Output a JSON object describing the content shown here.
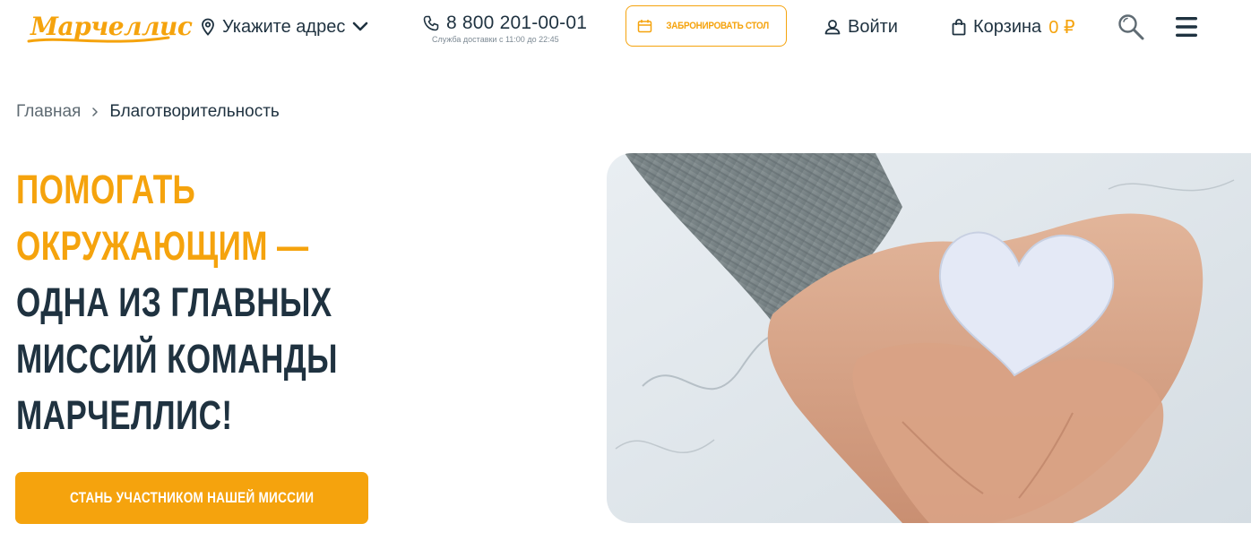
{
  "header": {
    "logo_text": "Марчеллис",
    "address_label": "Укажите адрес",
    "phone_number": "8 800 201-00-01",
    "phone_hours": "Служба доставки с 11:00 до 22:45",
    "book_table_label": "Забронировать стол",
    "login_label": "Войти",
    "cart_label": "Корзина",
    "cart_amount": "0 ₽",
    "icons": {
      "address": "location-pin-icon",
      "address_dropdown": "chevron-down-icon",
      "phone": "phone-icon",
      "book": "calendar-icon",
      "login": "user-icon",
      "cart": "shopping-bag-icon",
      "search": "search-icon",
      "menu": "hamburger-menu-icon"
    }
  },
  "breadcrumb": {
    "home": "Главная",
    "current": "Благотворительность"
  },
  "hero": {
    "title_accent_line1": "Помогать",
    "title_accent_line2": "окружающим —",
    "title_line3": "одна из главных",
    "title_line4": "миссий команды",
    "title_line5": "Марчеллис!",
    "cta_label": "Стань участником нашей миссии"
  },
  "colors": {
    "accent": "#f5a30d",
    "text_dark": "#1f3240",
    "text_muted": "#5f6b73"
  }
}
